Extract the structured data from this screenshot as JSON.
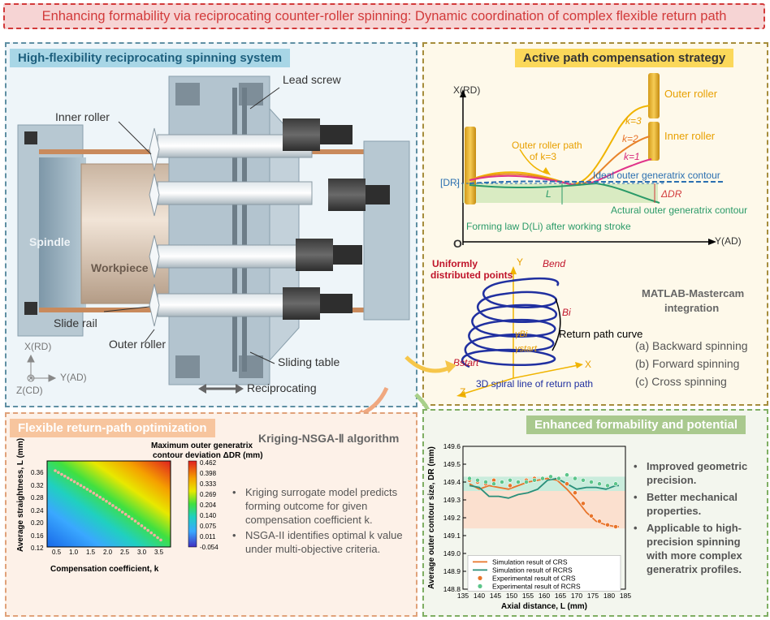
{
  "title": "Enhancing formability via reciprocating counter-roller spinning: Dynamic coordination of complex flexible return path",
  "panel_spinning": {
    "title": "High-flexibility reciprocating spinning system",
    "labels": {
      "lead_screw": "Lead screw",
      "inner_roller": "Inner roller",
      "spindle": "Spindle",
      "workpiece": "Workpiece",
      "slide_rail": "Slide rail",
      "outer_roller": "Outer roller",
      "sliding_table": "Sliding table",
      "reciprocating": "Reciprocating",
      "axis_x": "X(RD)",
      "axis_y": "Y(AD)",
      "axis_z": "Z(CD)"
    }
  },
  "panel_compensation": {
    "title": "Active path compensation strategy",
    "labels": {
      "axis_x": "X(RD)",
      "axis_y": "Y(AD)",
      "origin": "O",
      "outer_roller": "Outer roller",
      "inner_roller": "Inner roller",
      "k3": "k=3",
      "k2": "k=2",
      "k1": "k=1",
      "outer_path": "Outer roller path",
      "outer_path2": "of k=3",
      "dr_bracket": "[DR]",
      "ideal": "Ideal outer generatrix contour",
      "delta": "ΔDR",
      "actual": "Actural outer generatrix contour",
      "L": "L",
      "forming_law": "Forming law D(Li) after working stroke",
      "uniform1": "Uniformly",
      "uniform2": "distributed points",
      "b_end": "Bend",
      "b_i": "Bi",
      "b_start": "Bstart",
      "gamma_bi": "γBi",
      "gamma_start": "γstart",
      "return_curve": "Return path curve",
      "spiral_caption": "3D spiral line of return path",
      "spiral_x": "X",
      "spiral_y": "Y",
      "spiral_z": "Z",
      "matlab1": "MATLAB-Mastercam",
      "matlab2": "integration",
      "mode_a": "(a) Backward spinning",
      "mode_b": "(b) Forward spinning",
      "mode_c": "(c) Cross spinning"
    }
  },
  "panel_optimization": {
    "title": "Flexible return-path optimization",
    "algorithm": "Kriging-NSGA-Ⅱ algorithm",
    "colorbar_title1": "Maximum outer generatrix",
    "colorbar_title2": "contour deviation ΔDR (mm)",
    "colorbar_ticks": [
      "0.462",
      "0.398",
      "0.333",
      "0.269",
      "0.204",
      "0.140",
      "0.075",
      "0.011",
      "-0.054"
    ],
    "xlabel": "Compensation coefficient, k",
    "ylabel": "Average straightness, L (mm)",
    "xticks": [
      "0.5",
      "1.0",
      "1.5",
      "2.0",
      "2.5",
      "3.0",
      "3.5"
    ],
    "yticks": [
      "0.36",
      "0.32",
      "0.28",
      "0.24",
      "0.20",
      "0.16",
      "0.12"
    ],
    "bullets": [
      "Kriging surrogate model predicts forming outcome for given compensation coefficient k.",
      "NSGA-II identifies optimal k value under multi-objective criteria."
    ]
  },
  "panel_formability": {
    "title": "Enhanced formability and potential",
    "bullets": [
      "Improved geometric precision.",
      "Better mechanical properties.",
      "Applicable to high-precision spinning with more complex generatrix profiles."
    ]
  },
  "chart_data": {
    "type": "line",
    "title": "",
    "xlabel": "Axial distance, L (mm)",
    "ylabel": "Average outer contour size, DR (mm)",
    "xlim": [
      135,
      185
    ],
    "ylim": [
      148.8,
      149.6
    ],
    "xticks": [
      "135",
      "140",
      "145",
      "150",
      "155",
      "160",
      "165",
      "170",
      "175",
      "180",
      "185"
    ],
    "yticks": [
      "149.6",
      "149.5",
      "149.4",
      "149.3",
      "149.2",
      "149.1",
      "149.0",
      "148.9",
      "148.8"
    ],
    "legend": "bottom-center",
    "series": [
      {
        "name": "Simulation result of CRS",
        "kind": "line",
        "color": "#e8742a",
        "x": [
          137,
          140,
          143,
          146,
          149,
          152,
          155,
          158,
          161,
          164,
          167,
          170,
          173,
          176,
          179,
          182,
          183
        ],
        "y": [
          149.39,
          149.36,
          149.38,
          149.37,
          149.36,
          149.38,
          149.4,
          149.41,
          149.42,
          149.41,
          149.36,
          149.3,
          149.23,
          149.18,
          149.16,
          149.15,
          149.15
        ]
      },
      {
        "name": "Simulation result of RCRS",
        "kind": "line",
        "color": "#2a8f7a",
        "x": [
          137,
          140,
          143,
          146,
          149,
          152,
          155,
          158,
          161,
          164,
          167,
          170,
          173,
          176,
          179,
          182,
          183
        ],
        "y": [
          149.38,
          149.37,
          149.32,
          149.32,
          149.31,
          149.33,
          149.34,
          149.36,
          149.41,
          149.42,
          149.39,
          149.36,
          149.37,
          149.37,
          149.36,
          149.38,
          149.38
        ]
      },
      {
        "name": "Experimental result of CRS",
        "kind": "scatter",
        "color": "#e8742a",
        "x": [
          137,
          139.5,
          142,
          144.5,
          147,
          149.5,
          152,
          154.5,
          157,
          159.5,
          162,
          164.5,
          167,
          169.5,
          172,
          174.5,
          177,
          179.5,
          182
        ],
        "y": [
          149.41,
          149.4,
          149.39,
          149.41,
          149.4,
          149.38,
          149.4,
          149.41,
          149.42,
          149.42,
          149.43,
          149.42,
          149.39,
          149.34,
          149.28,
          149.21,
          149.18,
          149.16,
          149.15
        ]
      },
      {
        "name": "Experimental result of RCRS",
        "kind": "scatter",
        "color": "#5cc58a",
        "x": [
          137,
          139.5,
          142,
          144.5,
          147,
          149.5,
          152,
          154.5,
          157,
          159.5,
          162,
          164.5,
          167,
          169.5,
          172,
          174.5,
          177,
          179.5,
          182
        ],
        "y": [
          149.42,
          149.41,
          149.4,
          149.39,
          149.4,
          149.41,
          149.4,
          149.4,
          149.41,
          149.42,
          149.43,
          149.42,
          149.44,
          149.42,
          149.41,
          149.4,
          149.39,
          149.38,
          149.39
        ]
      }
    ]
  }
}
